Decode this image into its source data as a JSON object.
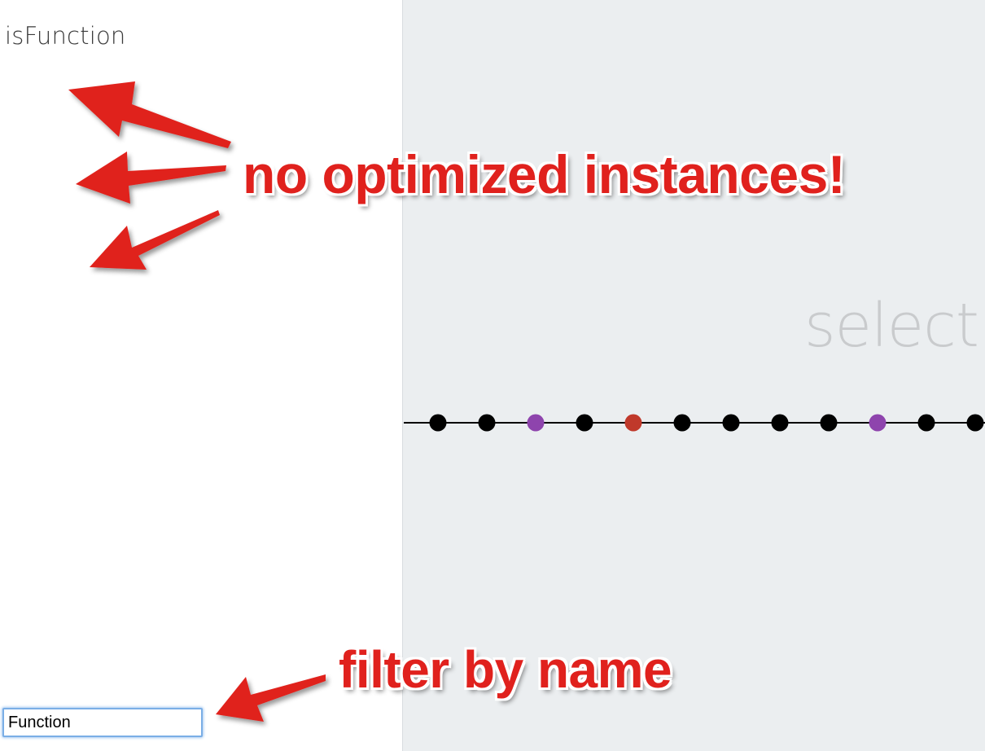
{
  "left_pane": {
    "function_name": "isFunction",
    "filter_input_value": "Function"
  },
  "right_pane": {
    "placeholder_text": "select",
    "timeline": {
      "line_color": "#000000",
      "dots": [
        {
          "color": "#000000"
        },
        {
          "color": "#000000"
        },
        {
          "color": "#8e44ad"
        },
        {
          "color": "#000000"
        },
        {
          "color": "#c0392b"
        },
        {
          "color": "#000000"
        },
        {
          "color": "#000000"
        },
        {
          "color": "#000000"
        },
        {
          "color": "#000000"
        },
        {
          "color": "#8e44ad"
        },
        {
          "color": "#000000"
        },
        {
          "color": "#000000"
        }
      ]
    }
  },
  "annotations": {
    "no_optimized": "no optimized instances!",
    "filter_by_name": "filter by name",
    "arrow_color": "#e0211d",
    "arrow_icon": "arrow-icon"
  }
}
